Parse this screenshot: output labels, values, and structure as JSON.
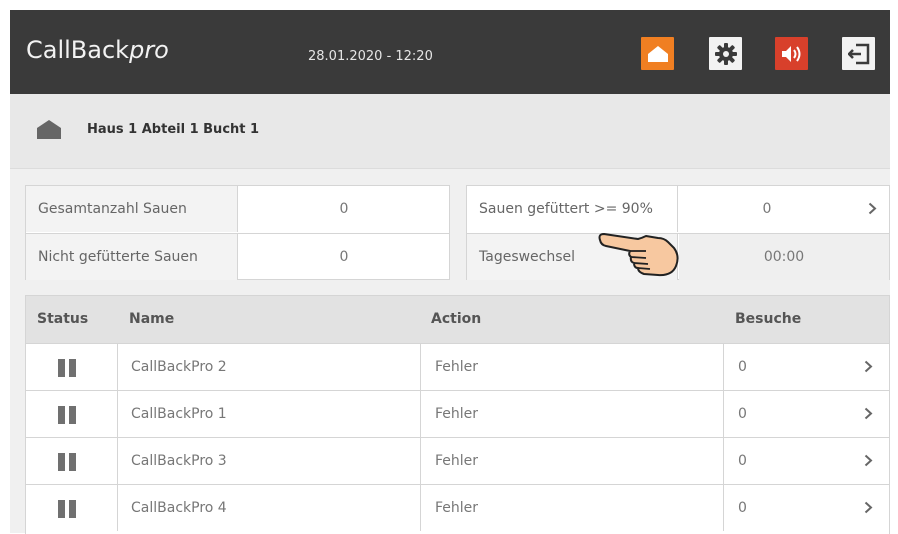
{
  "header": {
    "brand_main": "CallBack",
    "brand_italic": "pro",
    "datetime": "28.01.2020 - 12:20",
    "buttons": [
      "home-icon",
      "gear-icon",
      "speaker-icon",
      "logout-icon"
    ],
    "colors": {
      "bar": "#3a3a3a",
      "home": "#f07f22",
      "sound": "#d8402b"
    }
  },
  "breadcrumb": {
    "text": "Haus 1 Abteil 1 Bucht 1"
  },
  "summary_left": [
    {
      "label": "Gesamtanzahl Sauen",
      "value": "0"
    },
    {
      "label": "Nicht gefütterte Sauen",
      "value": "0"
    }
  ],
  "summary_right": [
    {
      "label": "Sauen gefüttert >= 90%",
      "value": "0"
    },
    {
      "label": "Tageswechsel",
      "value": "00:00"
    }
  ],
  "table": {
    "headers": [
      "Status",
      "Name",
      "Action",
      "Besuche"
    ],
    "rows": [
      {
        "name": "CallBackPro 2",
        "action": "Fehler",
        "besuche": "0"
      },
      {
        "name": "CallBackPro 1",
        "action": "Fehler",
        "besuche": "0"
      },
      {
        "name": "CallBackPro 3",
        "action": "Fehler",
        "besuche": "0"
      },
      {
        "name": "CallBackPro 4",
        "action": "Fehler",
        "besuche": "0"
      }
    ]
  }
}
